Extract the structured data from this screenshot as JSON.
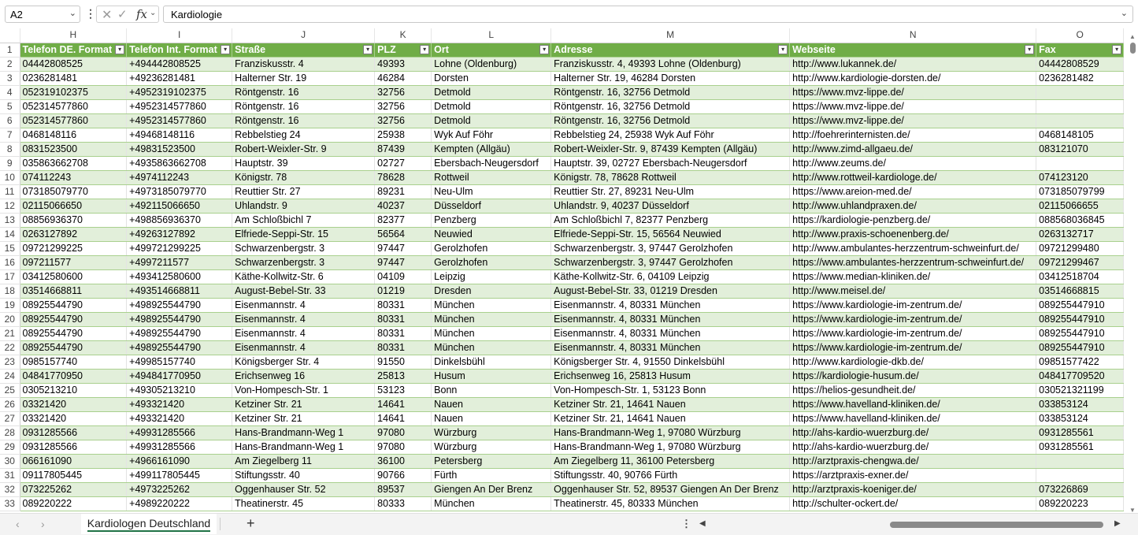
{
  "formula_bar": {
    "name_box": "A2",
    "fx": "fx",
    "content": "Kardiologie"
  },
  "columns": [
    "H",
    "I",
    "J",
    "K",
    "L",
    "M",
    "N",
    "O"
  ],
  "headers": [
    "Telefon DE. Format",
    "Telefon Int. Format",
    "Straße",
    "PLZ",
    "Ort",
    "Adresse",
    "Webseite",
    "Fax"
  ],
  "row_numbers": [
    "1",
    "2",
    "3",
    "4",
    "5",
    "6",
    "7",
    "8",
    "9",
    "10",
    "11",
    "12",
    "13",
    "14",
    "15",
    "16",
    "17",
    "18",
    "19",
    "20",
    "21",
    "22",
    "23",
    "24",
    "25",
    "26",
    "27",
    "28",
    "29",
    "30",
    "31",
    "32",
    "33"
  ],
  "rows": [
    [
      "04442808525",
      "+494442808525",
      "Franziskusstr. 4",
      "49393",
      "Lohne (Oldenburg)",
      "Franziskusstr. 4, 49393 Lohne (Oldenburg)",
      "http://www.lukannek.de/",
      "04442808529"
    ],
    [
      "0236281481",
      "+49236281481",
      "Halterner Str. 19",
      "46284",
      "Dorsten",
      "Halterner Str. 19, 46284 Dorsten",
      "http://www.kardiologie-dorsten.de/",
      "0236281482"
    ],
    [
      "052319102375",
      "+4952319102375",
      "Röntgenstr. 16",
      "32756",
      "Detmold",
      "Röntgenstr. 16, 32756 Detmold",
      "https://www.mvz-lippe.de/",
      ""
    ],
    [
      "052314577860",
      "+4952314577860",
      "Röntgenstr. 16",
      "32756",
      "Detmold",
      "Röntgenstr. 16, 32756 Detmold",
      "https://www.mvz-lippe.de/",
      ""
    ],
    [
      "052314577860",
      "+4952314577860",
      "Röntgenstr. 16",
      "32756",
      "Detmold",
      "Röntgenstr. 16, 32756 Detmold",
      "https://www.mvz-lippe.de/",
      ""
    ],
    [
      "0468148116",
      "+49468148116",
      "Rebbelstieg 24",
      "25938",
      "Wyk Auf Föhr",
      "Rebbelstieg 24, 25938 Wyk Auf Föhr",
      "http://foehrerinternisten.de/",
      "0468148105"
    ],
    [
      "0831523500",
      "+49831523500",
      "Robert-Weixler-Str. 9",
      "87439",
      "Kempten (Allgäu)",
      "Robert-Weixler-Str. 9, 87439 Kempten (Allgäu)",
      "http://www.zimd-allgaeu.de/",
      "083121070"
    ],
    [
      "035863662708",
      "+4935863662708",
      "Hauptstr. 39",
      "02727",
      "Ebersbach-Neugersdorf",
      "Hauptstr. 39, 02727 Ebersbach-Neugersdorf",
      "http://www.zeums.de/",
      ""
    ],
    [
      "074112243",
      "+4974112243",
      "Königstr. 78",
      "78628",
      "Rottweil",
      "Königstr. 78, 78628 Rottweil",
      "http://www.rottweil-kardiologe.de/",
      "074123120"
    ],
    [
      "073185079770",
      "+4973185079770",
      "Reuttier Str. 27",
      "89231",
      "Neu-Ulm",
      "Reuttier Str. 27, 89231 Neu-Ulm",
      "https://www.areion-med.de/",
      "073185079799"
    ],
    [
      "02115066650",
      "+492115066650",
      "Uhlandstr. 9",
      "40237",
      "Düsseldorf",
      "Uhlandstr. 9, 40237 Düsseldorf",
      "http://www.uhlandpraxen.de/",
      "02115066655"
    ],
    [
      "08856936370",
      "+498856936370",
      "Am Schloßbichl 7",
      "82377",
      "Penzberg",
      "Am Schloßbichl 7, 82377 Penzberg",
      "https://kardiologie-penzberg.de/",
      "088568036845"
    ],
    [
      "0263127892",
      "+49263127892",
      "Elfriede-Seppi-Str. 15",
      "56564",
      "Neuwied",
      "Elfriede-Seppi-Str. 15, 56564 Neuwied",
      "http://www.praxis-schoenenberg.de/",
      "0263132717"
    ],
    [
      "09721299225",
      "+499721299225",
      "Schwarzenbergstr. 3",
      "97447",
      "Gerolzhofen",
      "Schwarzenbergstr. 3, 97447 Gerolzhofen",
      "http://www.ambulantes-herzzentrum-schweinfurt.de/",
      "09721299480"
    ],
    [
      "097211577",
      "+4997211577",
      "Schwarzenbergstr. 3",
      "97447",
      "Gerolzhofen",
      "Schwarzenbergstr. 3, 97447 Gerolzhofen",
      "https://www.ambulantes-herzzentrum-schweinfurt.de/",
      "09721299467"
    ],
    [
      "03412580600",
      "+493412580600",
      "Käthe-Kollwitz-Str. 6",
      "04109",
      "Leipzig",
      "Käthe-Kollwitz-Str. 6, 04109 Leipzig",
      "https://www.median-kliniken.de/",
      "03412518704"
    ],
    [
      "03514668811",
      "+493514668811",
      "August-Bebel-Str. 33",
      "01219",
      "Dresden",
      "August-Bebel-Str. 33, 01219 Dresden",
      "http://www.meisel.de/",
      "03514668815"
    ],
    [
      "08925544790",
      "+498925544790",
      "Eisenmannstr. 4",
      "80331",
      "München",
      "Eisenmannstr. 4, 80331 München",
      "https://www.kardiologie-im-zentrum.de/",
      "089255447910"
    ],
    [
      "08925544790",
      "+498925544790",
      "Eisenmannstr. 4",
      "80331",
      "München",
      "Eisenmannstr. 4, 80331 München",
      "https://www.kardiologie-im-zentrum.de/",
      "089255447910"
    ],
    [
      "08925544790",
      "+498925544790",
      "Eisenmannstr. 4",
      "80331",
      "München",
      "Eisenmannstr. 4, 80331 München",
      "https://www.kardiologie-im-zentrum.de/",
      "089255447910"
    ],
    [
      "08925544790",
      "+498925544790",
      "Eisenmannstr. 4",
      "80331",
      "München",
      "Eisenmannstr. 4, 80331 München",
      "https://www.kardiologie-im-zentrum.de/",
      "089255447910"
    ],
    [
      "0985157740",
      "+49985157740",
      "Königsberger Str. 4",
      "91550",
      "Dinkelsbühl",
      "Königsberger Str. 4, 91550 Dinkelsbühl",
      "http://www.kardiologie-dkb.de/",
      "09851577422"
    ],
    [
      "04841770950",
      "+494841770950",
      "Erichsenweg 16",
      "25813",
      "Husum",
      "Erichsenweg 16, 25813 Husum",
      "https://kardiologie-husum.de/",
      "048417709520"
    ],
    [
      "0305213210",
      "+49305213210",
      "Von-Hompesch-Str. 1",
      "53123",
      "Bonn",
      "Von-Hompesch-Str. 1, 53123 Bonn",
      "https://helios-gesundheit.de/",
      "030521321199"
    ],
    [
      "03321420",
      "+493321420",
      "Ketziner Str. 21",
      "14641",
      "Nauen",
      "Ketziner Str. 21, 14641 Nauen",
      "https://www.havelland-kliniken.de/",
      "033853124"
    ],
    [
      "03321420",
      "+493321420",
      "Ketziner Str. 21",
      "14641",
      "Nauen",
      "Ketziner Str. 21, 14641 Nauen",
      "https://www.havelland-kliniken.de/",
      "033853124"
    ],
    [
      "0931285566",
      "+49931285566",
      "Hans-Brandmann-Weg 1",
      "97080",
      "Würzburg",
      "Hans-Brandmann-Weg 1, 97080 Würzburg",
      "http://ahs-kardio-wuerzburg.de/",
      "0931285561"
    ],
    [
      "0931285566",
      "+49931285566",
      "Hans-Brandmann-Weg 1",
      "97080",
      "Würzburg",
      "Hans-Brandmann-Weg 1, 97080 Würzburg",
      "http://ahs-kardio-wuerzburg.de/",
      "0931285561"
    ],
    [
      "066161090",
      "+4966161090",
      "Am Ziegelberg 11",
      "36100",
      "Petersberg",
      "Am Ziegelberg 11, 36100 Petersberg",
      "http://arztpraxis-chengwa.de/",
      ""
    ],
    [
      "09117805445",
      "+499117805445",
      "Stiftungsstr. 40",
      "90766",
      "Fürth",
      "Stiftungsstr. 40, 90766 Fürth",
      "https://arztpraxis-exner.de/",
      ""
    ],
    [
      "073225262",
      "+4973225262",
      "Oggenhauser Str. 52",
      "89537",
      "Giengen An Der Brenz",
      "Oggenhauser Str. 52, 89537 Giengen An Der Brenz",
      "http://arztpraxis-koeniger.de/",
      "073226869"
    ],
    [
      "089220222",
      "+4989220222",
      "Theatinerstr. 45",
      "80333",
      "München",
      "Theatinerstr. 45, 80333 München",
      "http://schulter-ockert.de/",
      "089220223"
    ]
  ],
  "sheet_tabs": [
    {
      "label": "Kardiologen Deutschland",
      "active": true
    }
  ],
  "add_sheet_label": "+",
  "colors": {
    "header_green": "#70ad47",
    "band_green": "#e2efda",
    "border_green": "#a9d08e",
    "tab_underline": "#217346"
  }
}
